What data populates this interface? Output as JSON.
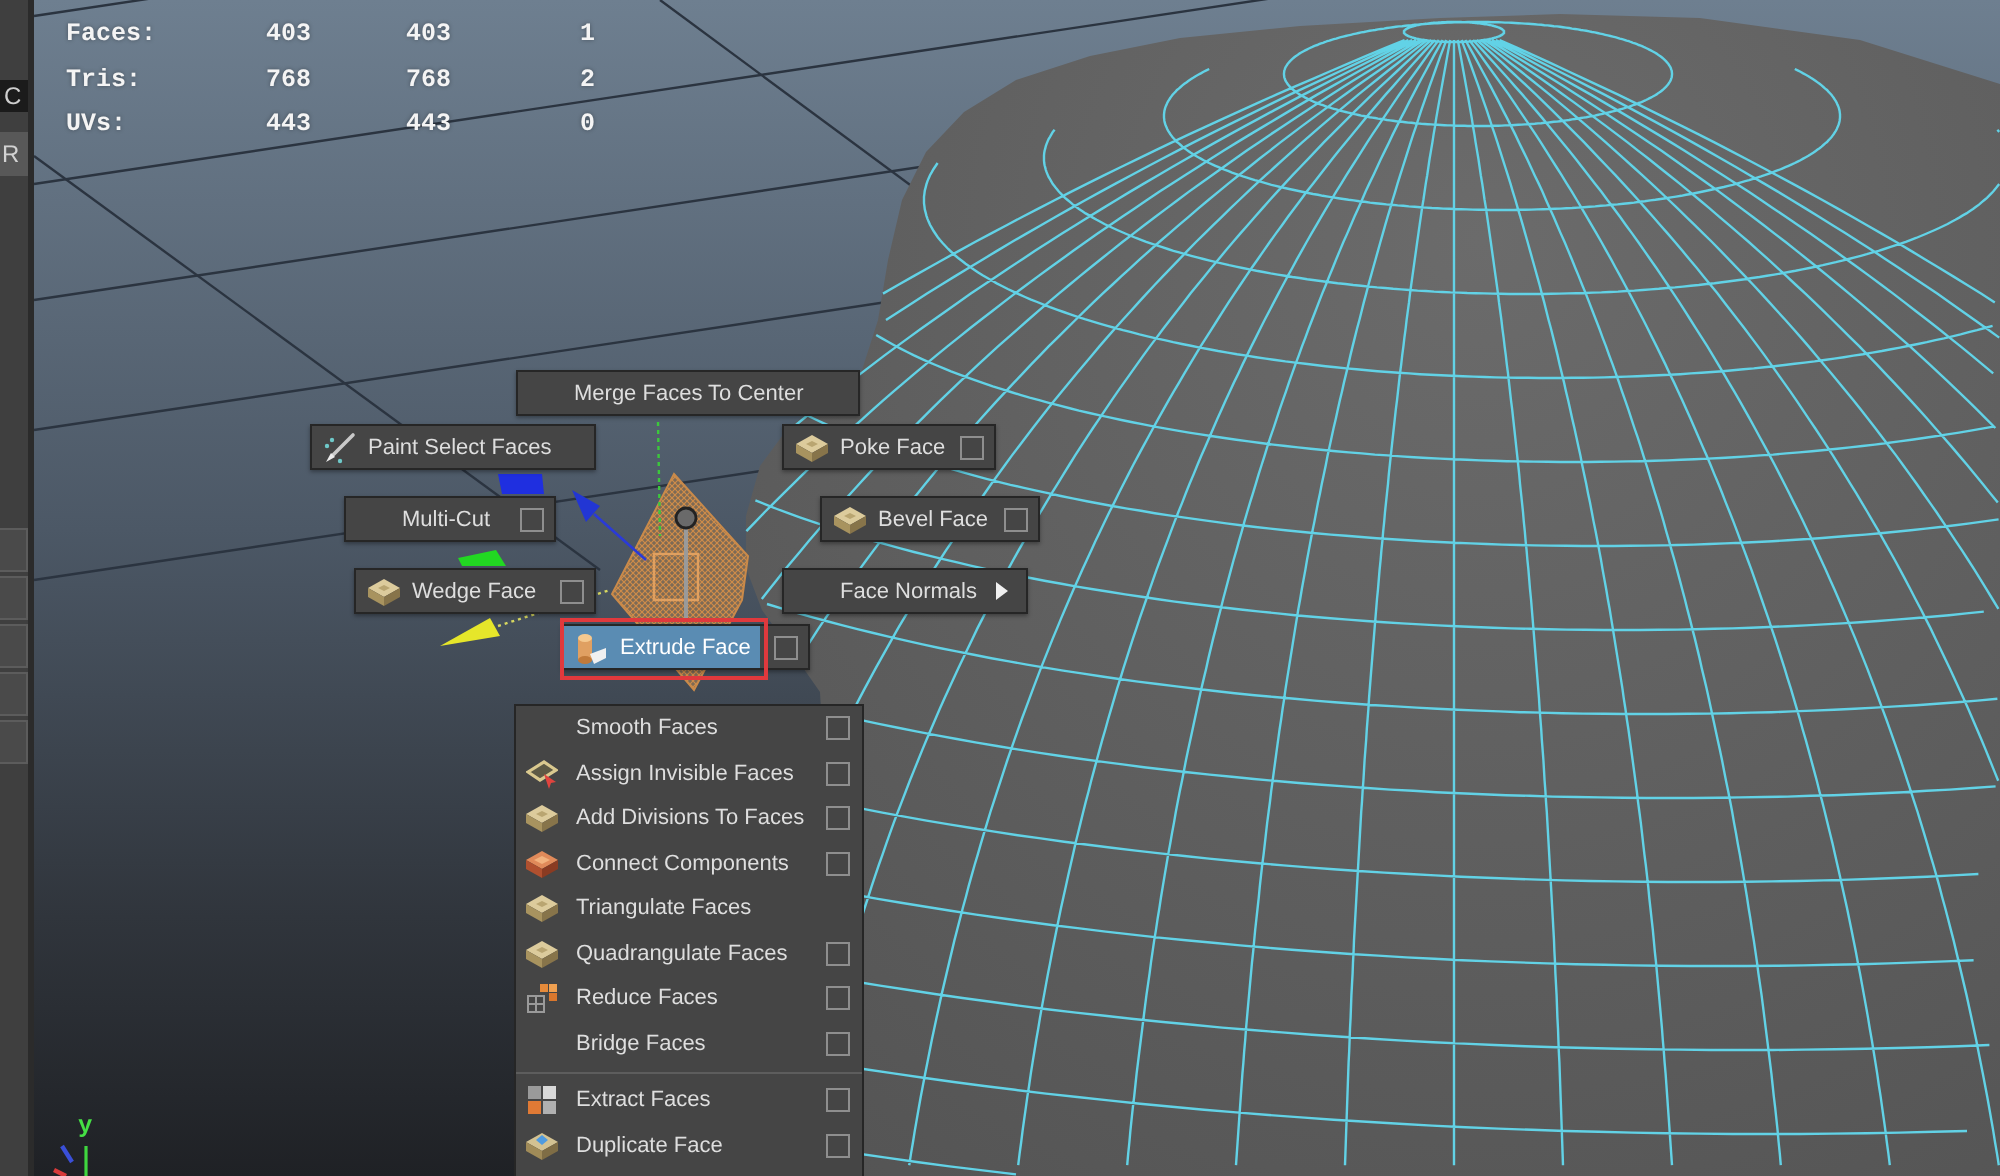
{
  "side_panel": {
    "buttons": [
      {
        "label": "C",
        "kind": "field"
      },
      {
        "label": "R",
        "kind": "button"
      }
    ]
  },
  "hud": {
    "rows": [
      {
        "label": "Faces:",
        "values": [
          "403",
          "403",
          "1"
        ]
      },
      {
        "label": "Tris:",
        "values": [
          "768",
          "768",
          "2"
        ]
      },
      {
        "label": "UVs:",
        "values": [
          "443",
          "443",
          "0"
        ]
      }
    ]
  },
  "marking_menu": {
    "items": [
      {
        "label": "Merge Faces To Center",
        "option_box": false,
        "submenu": false,
        "selected": false,
        "outlined": false
      },
      {
        "label": "Paint Select Faces",
        "option_box": false,
        "submenu": false,
        "selected": false,
        "outlined": false
      },
      {
        "label": "Poke Face",
        "option_box": true,
        "submenu": false,
        "selected": false,
        "outlined": false
      },
      {
        "label": "Multi-Cut",
        "option_box": true,
        "submenu": false,
        "selected": false,
        "outlined": false
      },
      {
        "label": "Bevel Face",
        "option_box": true,
        "submenu": false,
        "selected": false,
        "outlined": false
      },
      {
        "label": "Wedge Face",
        "option_box": true,
        "submenu": false,
        "selected": false,
        "outlined": false
      },
      {
        "label": "Face Normals",
        "option_box": false,
        "submenu": true,
        "selected": false,
        "outlined": false
      },
      {
        "label": "Extrude Face",
        "option_box": true,
        "submenu": false,
        "selected": true,
        "outlined": true
      }
    ]
  },
  "menu": {
    "groups": [
      {
        "items": [
          {
            "label": "Smooth Faces",
            "option_box": true,
            "selected": false
          },
          {
            "label": "Assign Invisible Faces",
            "option_box": true,
            "selected": false
          },
          {
            "label": "Add Divisions To Faces",
            "option_box": true,
            "selected": false
          },
          {
            "label": "Connect Components",
            "option_box": true,
            "selected": false
          },
          {
            "label": "Triangulate Faces",
            "option_box": false,
            "selected": false
          },
          {
            "label": "Quadrangulate Faces",
            "option_box": true,
            "selected": false
          },
          {
            "label": "Reduce Faces",
            "option_box": true,
            "selected": false
          },
          {
            "label": "Bridge Faces",
            "option_box": true,
            "selected": false
          }
        ]
      },
      {
        "items": [
          {
            "label": "Extract Faces",
            "option_box": true,
            "selected": false
          },
          {
            "label": "Duplicate Face",
            "option_box": true,
            "selected": false
          }
        ]
      }
    ]
  },
  "axis": {
    "label": "y"
  }
}
